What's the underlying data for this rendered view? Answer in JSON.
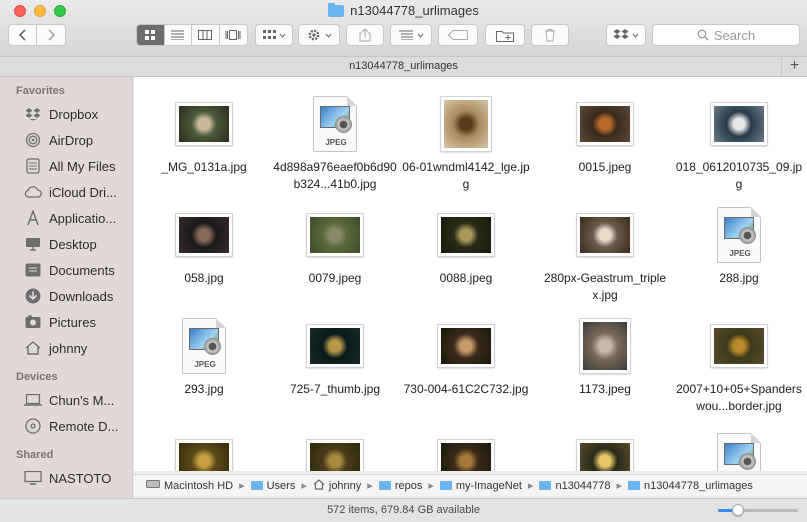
{
  "window": {
    "title": "n13044778_urlimages",
    "path_title": "n13044778_urlimages"
  },
  "toolbar": {
    "search_placeholder": "Search",
    "view_modes": [
      "icon-view",
      "list-view",
      "column-view",
      "cover-flow-view"
    ],
    "selected_view": "icon-view"
  },
  "sidebar": {
    "sections": [
      {
        "title": "Favorites",
        "items": [
          {
            "label": "Dropbox",
            "icon": "dropbox-icon"
          },
          {
            "label": "AirDrop",
            "icon": "airdrop-icon"
          },
          {
            "label": "All My Files",
            "icon": "all-files-icon"
          },
          {
            "label": "iCloud Dri...",
            "icon": "icloud-icon"
          },
          {
            "label": "Applicatio...",
            "icon": "applications-icon"
          },
          {
            "label": "Desktop",
            "icon": "desktop-icon"
          },
          {
            "label": "Documents",
            "icon": "documents-icon"
          },
          {
            "label": "Downloads",
            "icon": "downloads-icon"
          },
          {
            "label": "Pictures",
            "icon": "pictures-icon"
          },
          {
            "label": "johnny",
            "icon": "home-icon"
          }
        ]
      },
      {
        "title": "Devices",
        "items": [
          {
            "label": "Chun's M...",
            "icon": "laptop-icon"
          },
          {
            "label": "Remote D...",
            "icon": "remote-disc-icon"
          }
        ]
      },
      {
        "title": "Shared",
        "items": [
          {
            "label": "NASTOTO",
            "icon": "server-icon"
          }
        ]
      }
    ]
  },
  "files": [
    {
      "name": "_MG_0131a.jpg",
      "kind": "photo",
      "colors": [
        "#4a5a3a",
        "#c8b898",
        "#2a2a1a"
      ]
    },
    {
      "name": "4d898a976eaef0b6d90b324...41b0.jpg",
      "kind": "generic"
    },
    {
      "name": "06-01wndml4142_lge.jpg",
      "kind": "photo",
      "colors": [
        "#a88860",
        "#5a3a1a",
        "#d8c8a8"
      ]
    },
    {
      "name": "0015.jpeg",
      "kind": "photo",
      "colors": [
        "#3a2a1a",
        "#b86a2a",
        "#5a4a3a"
      ]
    },
    {
      "name": "018_0612010735_09.jpg",
      "kind": "photo",
      "colors": [
        "#2a3a4a",
        "#e8e8e8",
        "#6a7a8a"
      ]
    },
    {
      "name": "058.jpg",
      "kind": "photo",
      "colors": [
        "#1a1a1a",
        "#8a6a5a",
        "#3a2a2a"
      ]
    },
    {
      "name": "0079.jpeg",
      "kind": "photo",
      "colors": [
        "#5a6a3a",
        "#8a8a6a",
        "#3a4a2a"
      ]
    },
    {
      "name": "0088.jpeg",
      "kind": "photo",
      "colors": [
        "#2a2a1a",
        "#a8985a",
        "#1a1a0a"
      ]
    },
    {
      "name": "280px-Geastrum_triplex.jpg",
      "kind": "photo",
      "colors": [
        "#6a5a4a",
        "#e8dcc8",
        "#3a2a1a"
      ]
    },
    {
      "name": "288.jpg",
      "kind": "generic"
    },
    {
      "name": "293.jpg",
      "kind": "generic"
    },
    {
      "name": "725-7_thumb.jpg",
      "kind": "photo",
      "colors": [
        "#0a1a1a",
        "#b8984a",
        "#1a2a2a"
      ]
    },
    {
      "name": "730-004-61C2C732.jpg",
      "kind": "photo",
      "colors": [
        "#3a2a1a",
        "#c89868",
        "#1a1a0a"
      ]
    },
    {
      "name": "1173.jpeg",
      "kind": "photo",
      "colors": [
        "#7a6a5a",
        "#c8b8a8",
        "#3a3a3a"
      ]
    },
    {
      "name": "2007+10+05+Spanderswou...border.jpg",
      "kind": "photo",
      "colors": [
        "#3a3a1a",
        "#b8882a",
        "#5a4a2a"
      ]
    },
    {
      "name": "",
      "kind": "photo",
      "colors": [
        "#5a4a1a",
        "#c8a040",
        "#3a2a0a"
      ]
    },
    {
      "name": "",
      "kind": "photo",
      "colors": [
        "#4a3a1a",
        "#a88a40",
        "#2a2a0a"
      ]
    },
    {
      "name": "",
      "kind": "photo",
      "colors": [
        "#3a2a1a",
        "#a87838",
        "#1a1a0a"
      ]
    },
    {
      "name": "",
      "kind": "photo",
      "colors": [
        "#2a2a1a",
        "#e8c868",
        "#5a4a2a"
      ]
    },
    {
      "name": "",
      "kind": "generic"
    }
  ],
  "breadcrumbs": [
    {
      "label": "Macintosh HD",
      "icon": "hard-drive-icon"
    },
    {
      "label": "Users",
      "icon": "folder-icon"
    },
    {
      "label": "johnny",
      "icon": "home-icon"
    },
    {
      "label": "repos",
      "icon": "folder-icon"
    },
    {
      "label": "my-ImageNet",
      "icon": "folder-icon"
    },
    {
      "label": "n13044778",
      "icon": "folder-icon"
    },
    {
      "label": "n13044778_urlimages",
      "icon": "folder-icon"
    }
  ],
  "status": {
    "text": "572 items, 679.84 GB available",
    "icon_size_level": 0.25
  }
}
